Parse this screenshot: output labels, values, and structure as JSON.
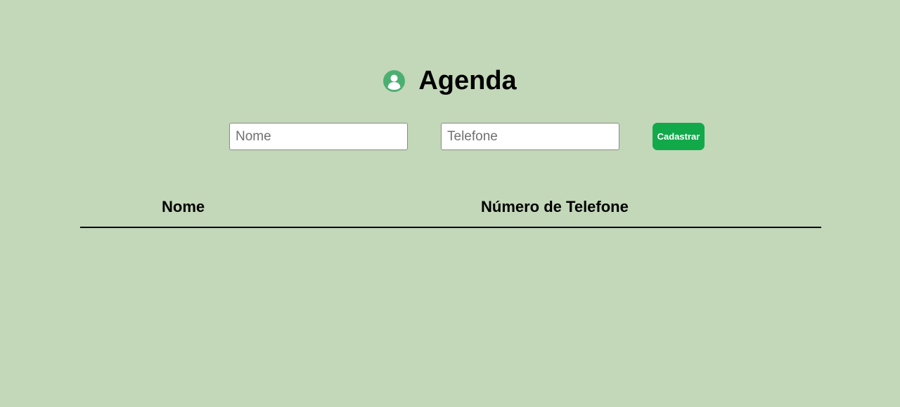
{
  "header": {
    "icon": "user-circle-icon",
    "title": "Agenda"
  },
  "form": {
    "nome_placeholder": "Nome",
    "nome_value": "",
    "telefone_placeholder": "Telefone",
    "telefone_value": "",
    "submit_label": "Cadastrar"
  },
  "table": {
    "columns": [
      "Nome",
      "Número de Telefone"
    ],
    "rows": []
  },
  "colors": {
    "background": "#c3d7b9",
    "icon_green": "#4caf72",
    "button_green": "#12a94b"
  }
}
